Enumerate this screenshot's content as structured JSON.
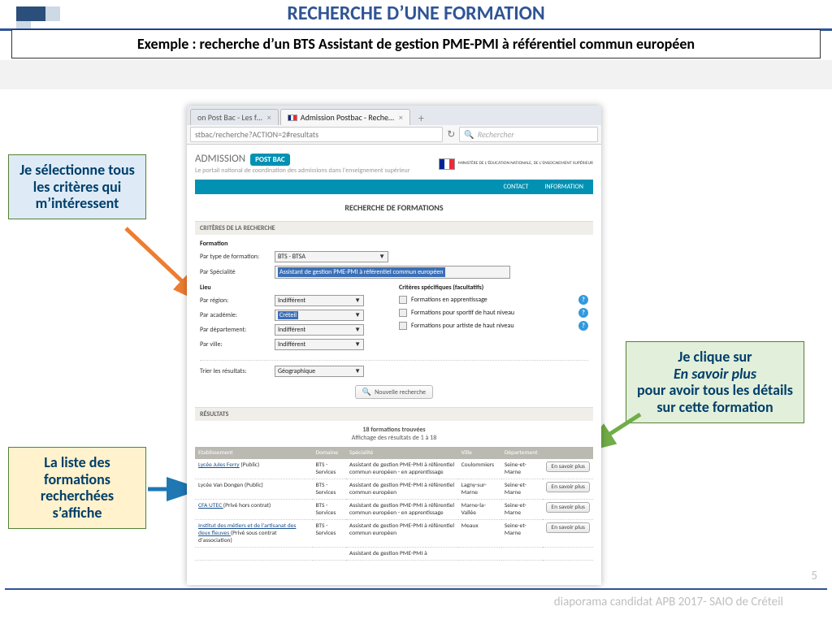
{
  "slide": {
    "title": "RECHERCHE D’UNE FORMATION",
    "subtitle": "Exemple : recherche d’un BTS Assistant de gestion PME-PMI à référentiel commun européen",
    "page_number": "5",
    "footer": "diaporama  candidat APB 2017- SAIO de Créteil"
  },
  "callouts": {
    "criteres": "Je sélectionne tous les critères qui m’intéressent",
    "liste": "La liste des formations recherchées s’affiche",
    "detail_line1": "Je clique sur",
    "detail_line2": "En savoir plus",
    "detail_line3": "pour avoir tous les détails",
    "detail_line4": "sur cette formation"
  },
  "browser": {
    "tabs": {
      "inactive": "on Post Bac - Les f…",
      "active": "Admission Postbac - Reche…",
      "close": "×",
      "plus": "+"
    },
    "url": "stbac/recherche?ACTION=2#resultats",
    "reload_icon": "↻",
    "search_placeholder": "Rechercher",
    "search_icon": "🔍",
    "header": {
      "logo_main": "ADMISSION",
      "logo_pill": "POST BAC",
      "subtitle": "Le portail national de coordination des admissions dans l'enseignement supérieur",
      "ministry": "MINISTÈRE DE L'ÉDUCATION NATIONALE, DE L'ENSEIGNEMENT SUPÉRIEUR"
    },
    "nav": {
      "contact": "CONTACT",
      "information": "INFORMATION"
    },
    "page_title": "RECHERCHE DE FORMATIONS",
    "criteria_header": "CRITÈRES DE LA RECHERCHE",
    "formation_label": "Formation",
    "rows": {
      "type": {
        "label": "Par type de formation:",
        "value": "BTS - BTSA"
      },
      "spec": {
        "label": "Par Spécialité",
        "value": "Assistant de gestion PME-PMI à référentiel commun européen"
      },
      "lieu_label": "Lieu",
      "crit_facul": "Critères spécifiques (facultatifs)",
      "region": {
        "label": "Par région:",
        "value": "Indifférent"
      },
      "academie": {
        "label": "Par académie:",
        "value": "Créteil"
      },
      "departement": {
        "label": "Par département:",
        "value": "Indifférent"
      },
      "ville": {
        "label": "Par ville:",
        "value": "Indifférent"
      },
      "tri": {
        "label": "Trier les résultats:",
        "value": "Géographique"
      }
    },
    "checks": {
      "apprentissage": "Formations en apprentissage",
      "sportif": "Formations pour sportif de haut niveau",
      "artiste": "Formations pour artiste de haut niveau",
      "info": "?"
    },
    "nouvelle": "Nouvelle recherche",
    "results_header": "RÉSULTATS",
    "results_count": "18 formations trouvées",
    "results_range": "Affichage des résultats de 1 à 18",
    "table": {
      "headers": {
        "etab": "Etablissement",
        "domaine": "Domaine",
        "spec": "Spécialité",
        "ville": "Ville",
        "dep": "Département",
        "action": ""
      },
      "btn": "En savoir plus",
      "rows": [
        {
          "etab_link": "Lycée Jules Ferry",
          "etab_note": " (Public)",
          "domaine": "BTS - Services",
          "spec": "Assistant de gestion PME-PMI à référentiel commun européen - en apprentissage",
          "ville": "Coulommiers",
          "dep": "Seine-et-Marne"
        },
        {
          "etab_link": "",
          "etab_note": "Lycée Van Dongen  (Public)",
          "domaine": "BTS - Services",
          "spec": "Assistant de gestion PME-PMI à référentiel commun européen",
          "ville": "Lagny-sur-Marne",
          "dep": "Seine-et-Marne"
        },
        {
          "etab_link": "CFA UTEC ",
          "etab_note": " (Privé hors contrat)",
          "domaine": "BTS - Services",
          "spec": "Assistant de gestion PME-PMI à référentiel commun européen - en apprentissage",
          "ville": "Marne-la-Vallée",
          "dep": "Seine-et-Marne"
        },
        {
          "etab_link": "Institut des métiers et de l'artisanat des deux fleuves ",
          "etab_note": " (Privé sous contrat d'association)",
          "domaine": "BTS - Services",
          "spec": "Assistant de gestion PME-PMI à référentiel commun européen",
          "ville": "Meaux",
          "dep": "Seine-et-Marne"
        },
        {
          "etab_link": "",
          "etab_note": "",
          "domaine": "",
          "spec": "Assistant de gestion PME-PMI à",
          "ville": "",
          "dep": ""
        }
      ]
    }
  }
}
